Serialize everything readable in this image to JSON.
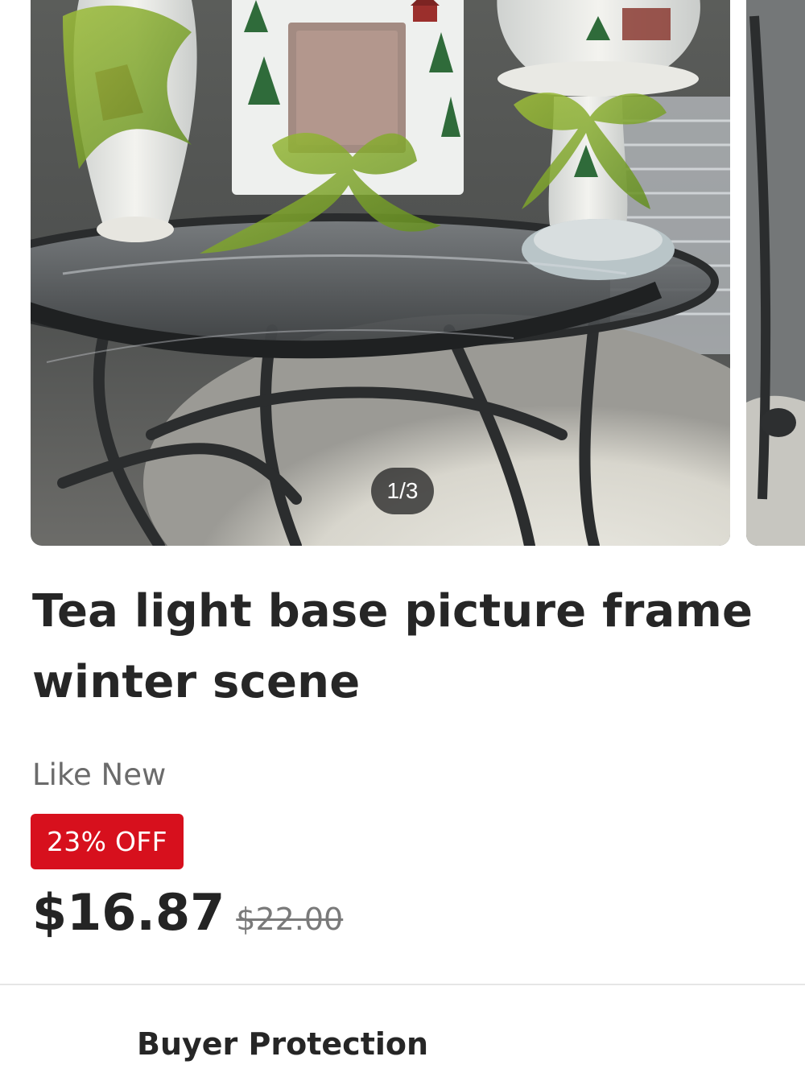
{
  "gallery": {
    "counter": "1/3",
    "current_image": 1,
    "total_images": 3,
    "main_image_alt": "Ceramic winter scene tea light, picture frame and vase with green ribbons on glass table",
    "next_image_alt": "Next product photo"
  },
  "product": {
    "title": "Tea light base picture frame winter scene",
    "condition": "Like New",
    "discount_badge": "23% OFF",
    "price": "$16.87",
    "original_price": "$22.00"
  },
  "sections": {
    "buyer_protection": "Buyer Protection"
  },
  "colors": {
    "discount_badge_bg": "#d7101d",
    "text_primary": "#262626",
    "text_secondary": "#6b6b6b",
    "divider": "#e6e6e6"
  }
}
